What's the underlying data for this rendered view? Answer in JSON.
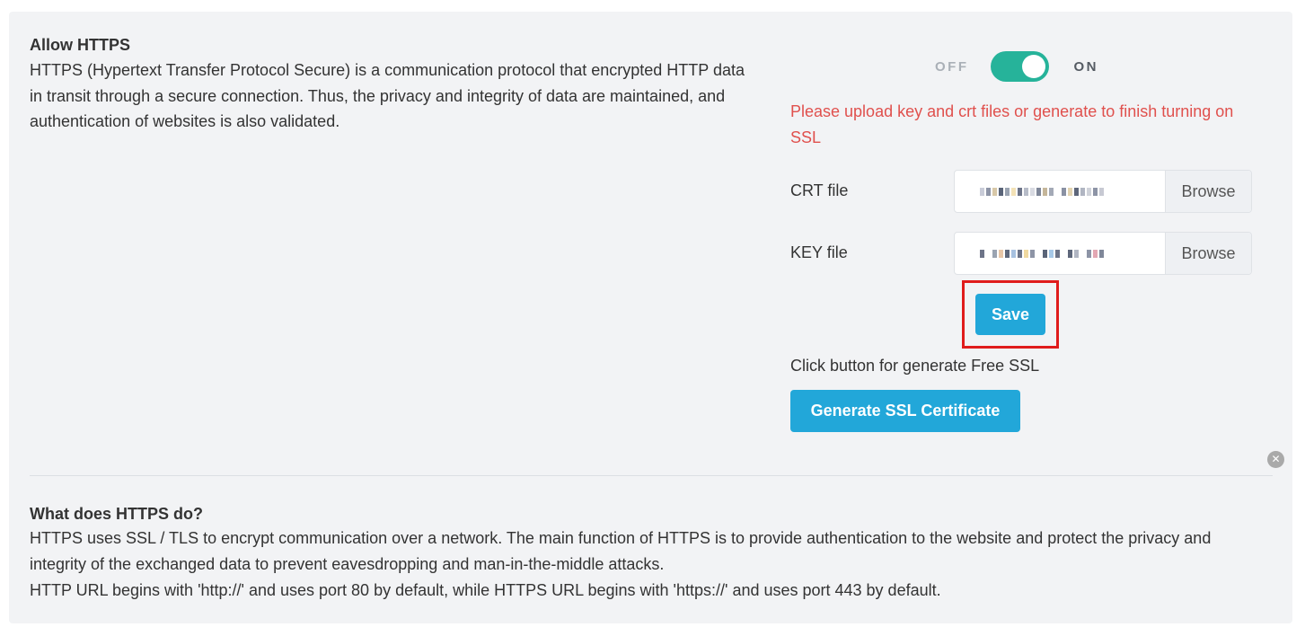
{
  "https": {
    "title": "Allow HTTPS",
    "description": "HTTPS (Hypertext Transfer Protocol Secure) is a communication protocol that encrypted HTTP data in transit through a secure connection. Thus, the privacy and integrity of data are maintained, and authentication of websites is also validated.",
    "toggle": {
      "off_label": "OFF",
      "on_label": "ON",
      "state": "on",
      "color": "#26b39a"
    },
    "warning": "Please upload key and crt files or generate to finish turning on SSL",
    "crt": {
      "label": "CRT file",
      "browse_label": "Browse"
    },
    "key": {
      "label": "KEY file",
      "browse_label": "Browse"
    },
    "save_label": "Save",
    "generate_text": "Click button for generate Free SSL",
    "generate_label": "Generate SSL Certificate"
  },
  "info": {
    "title": "What does HTTPS do?",
    "lines": [
      "HTTPS uses SSL / TLS to encrypt communication over a network. The main function of HTTPS is to provide authentication to the website and protect the privacy and",
      "integrity of the exchanged data to prevent eavesdropping and man-in-the-middle attacks.",
      "HTTP URL begins with 'http://' and uses port 80 by default, while HTTPS URL begins with 'https://' and uses port 443 by default."
    ]
  },
  "colors": {
    "accent": "#22a7d9",
    "warning": "#e0504d",
    "highlight": "#e01c1c",
    "toggle_on": "#26b39a"
  },
  "icons": {
    "close": "close-icon"
  }
}
